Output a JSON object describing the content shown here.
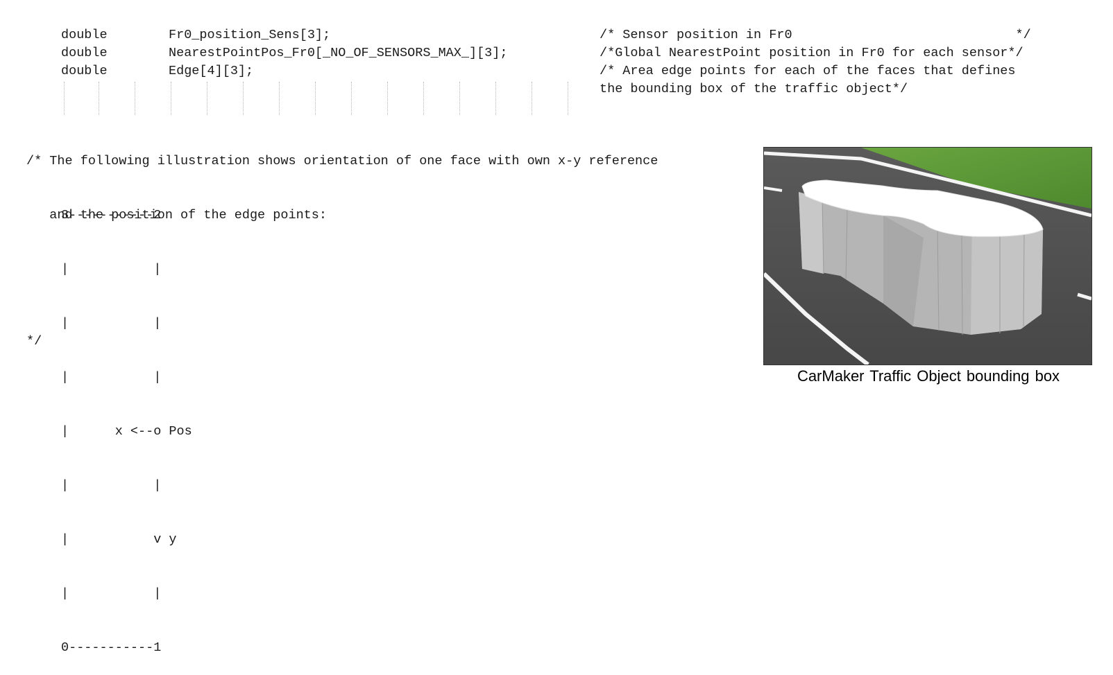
{
  "declarations": [
    {
      "type": "double",
      "name": "Fr0_position_Sens[3];",
      "comment": "/* Sensor position in Fr0                             */"
    },
    {
      "type": "double",
      "name": "NearestPointPos_Fr0[_NO_OF_SENSORS_MAX_][3];",
      "comment": "/*Global NearestPoint position in Fr0 for each sensor*/"
    },
    {
      "type": "double",
      "name": "Edge[4][3];",
      "comment": "/* Area edge points for each of the faces that defines"
    }
  ],
  "comment_continuation": "the bounding box of the traffic object*/",
  "illustration_comment": [
    "/* The following illustration shows orientation of one face with own x-y reference",
    "   and the position of the edge points:"
  ],
  "ascii_diagram": [
    "3-----------2",
    "|           |",
    "|           |",
    "|           |",
    "|      x <--o Pos",
    "|           |",
    "|           v y",
    "|           |",
    "0-----------1"
  ],
  "comment_close": "*/",
  "image": {
    "caption": "CarMaker Traffic Object bounding box",
    "colors": {
      "road": "#505050",
      "grass": "#5f9a38",
      "object_top": "#ffffff",
      "object_side": "#b9b9b9",
      "lane_marking": "#ffffff"
    }
  }
}
